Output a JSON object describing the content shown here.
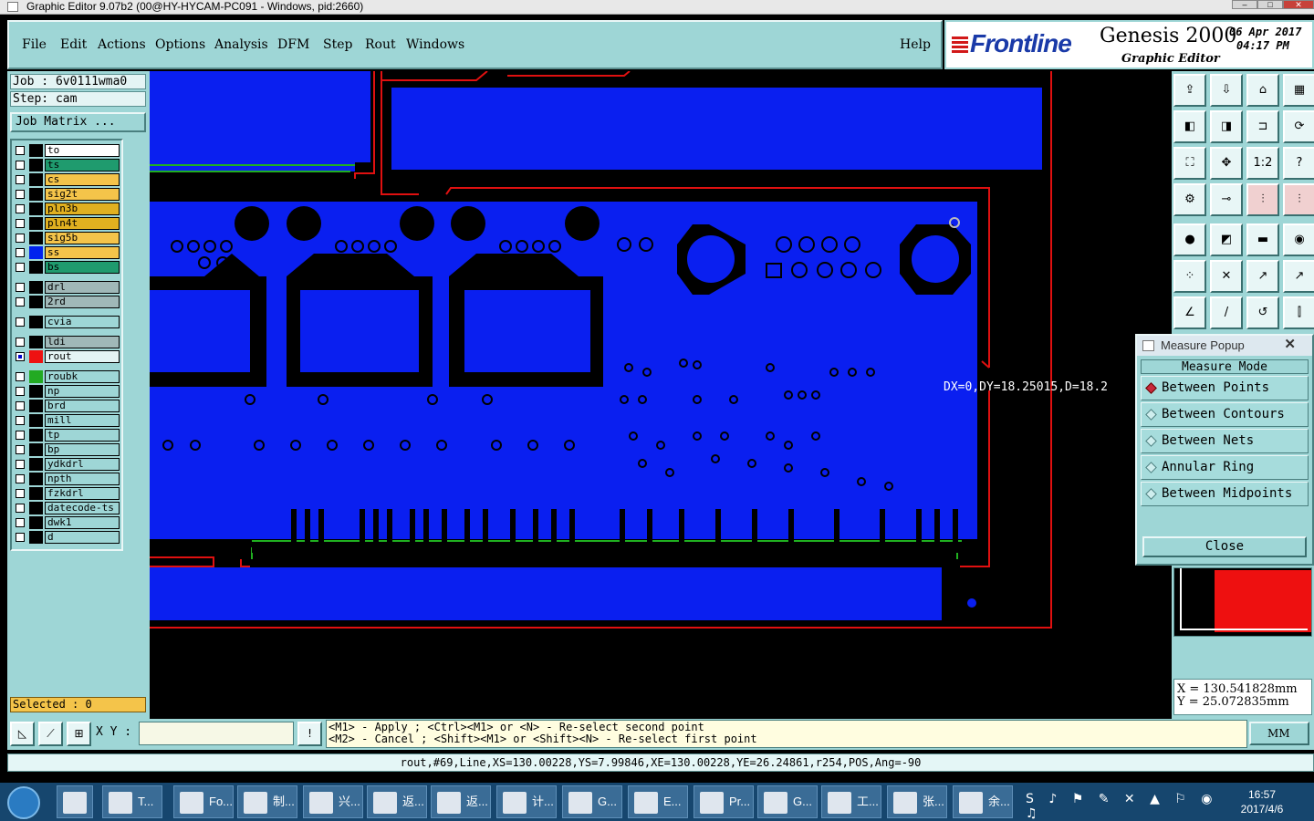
{
  "window": {
    "title": "Graphic Editor 9.07b2 (00@HY-HYCAM-PC091 - Windows, pid:2660)"
  },
  "menu": {
    "items": [
      "File",
      "Edit",
      "Actions",
      "Options",
      "Analysis",
      "DFM",
      "Step",
      "Rout",
      "Windows"
    ],
    "help": "Help"
  },
  "brand": {
    "company": "Frontline",
    "product": "Genesis 2000",
    "subtitle": "Graphic Editor",
    "date": "06 Apr 2017",
    "time": "04:17 PM"
  },
  "job": {
    "job_label": "Job : 6v0111wma0",
    "step_label": "Step: cam",
    "matrix_button": "Job Matrix ...",
    "selected": "Selected : 0"
  },
  "layers": [
    {
      "name": "to",
      "color": "#000000",
      "bg": "#ffffff",
      "checked": false
    },
    {
      "name": "ts",
      "color": "#000000",
      "bg": "#1f9b6e",
      "checked": false
    },
    {
      "name": "cs",
      "color": "#000000",
      "bg": "#f4c44a",
      "checked": false
    },
    {
      "name": "sig2t",
      "color": "#000000",
      "bg": "#f4c44a",
      "checked": false
    },
    {
      "name": "pln3b",
      "color": "#000000",
      "bg": "#e0b020",
      "checked": false
    },
    {
      "name": "pln4t",
      "color": "#000000",
      "bg": "#e0b020",
      "checked": false
    },
    {
      "name": "sig5b",
      "color": "#000000",
      "bg": "#f4c44a",
      "checked": false
    },
    {
      "name": "ss",
      "color": "#0022ee",
      "bg": "#f4c44a",
      "checked": false
    },
    {
      "name": "bs",
      "color": "#000000",
      "bg": "#1f9b6e",
      "checked": false
    },
    {
      "name": "drl",
      "color": "#000000",
      "bg": "#a0b8b8",
      "checked": false
    },
    {
      "name": "2rd",
      "color": "#000000",
      "bg": "#a0b8b8",
      "checked": false
    },
    {
      "name": "cvia",
      "color": "#000000",
      "bg": "#9ed6d6",
      "checked": false
    },
    {
      "name": "ldi",
      "color": "#000000",
      "bg": "#a0b8b8",
      "checked": false
    },
    {
      "name": "rout",
      "color": "#ee1111",
      "bg": "#e4f4f4",
      "checked": true
    },
    {
      "name": "roubk",
      "color": "#22aa22",
      "bg": "#9ed6d6",
      "checked": false
    },
    {
      "name": "np",
      "color": "#000000",
      "bg": "#9ed6d6",
      "checked": false
    },
    {
      "name": "brd",
      "color": "#000000",
      "bg": "#9ed6d6",
      "checked": false
    },
    {
      "name": "mill",
      "color": "#000000",
      "bg": "#9ed6d6",
      "checked": false
    },
    {
      "name": "tp",
      "color": "#000000",
      "bg": "#9ed6d6",
      "checked": false
    },
    {
      "name": "bp",
      "color": "#000000",
      "bg": "#9ed6d6",
      "checked": false
    },
    {
      "name": "ydkdrl",
      "color": "#000000",
      "bg": "#9ed6d6",
      "checked": false
    },
    {
      "name": "npth",
      "color": "#000000",
      "bg": "#9ed6d6",
      "checked": false
    },
    {
      "name": "fzkdrl",
      "color": "#000000",
      "bg": "#9ed6d6",
      "checked": false
    },
    {
      "name": "datecode-ts",
      "color": "#000000",
      "bg": "#9ed6d6",
      "checked": false
    },
    {
      "name": "dwk1",
      "color": "#000000",
      "bg": "#9ed6d6",
      "checked": false
    },
    {
      "name": "d",
      "color": "#000000",
      "bg": "#9ed6d6",
      "checked": false
    }
  ],
  "canvas": {
    "measure_readout": "DX=0,DY=18.25015,D=18.2"
  },
  "measure": {
    "title": "Measure Popup",
    "header": "Measure Mode",
    "options": [
      "Between Points",
      "Between Contours",
      "Between Nets",
      "Annular Ring",
      "Between Midpoints"
    ],
    "selected": "Between Points",
    "close": "Close"
  },
  "coords": {
    "x": "X = 130.541828mm",
    "y": "Y = 25.072835mm"
  },
  "tools": [
    "tool-1",
    "tool-2",
    "tool-3",
    "tool-4"
  ],
  "bottom": {
    "xy_label": "X Y :",
    "xy_value": "",
    "hint_line1": "<M1> - Apply  ; <Ctrl><M1> or <N> - Re-select second point",
    "hint_line2": "<M2> - Cancel ; <Shift><M1> or <Shift><N> - Re-select first point",
    "units": "MM"
  },
  "status": "rout,#69,Line,XS=130.00228,YS=7.99846,XE=130.00228,YE=26.24861,r254,POS,Ang=-90",
  "taskbar": {
    "apps": [
      "T...",
      "Fo...",
      "制...",
      "兴...",
      "返...",
      "返...",
      "计...",
      "G...",
      "E...",
      "Pr...",
      "G...",
      "工...",
      "张...",
      "余..."
    ],
    "time": "16:57",
    "date": "2017/4/6"
  }
}
